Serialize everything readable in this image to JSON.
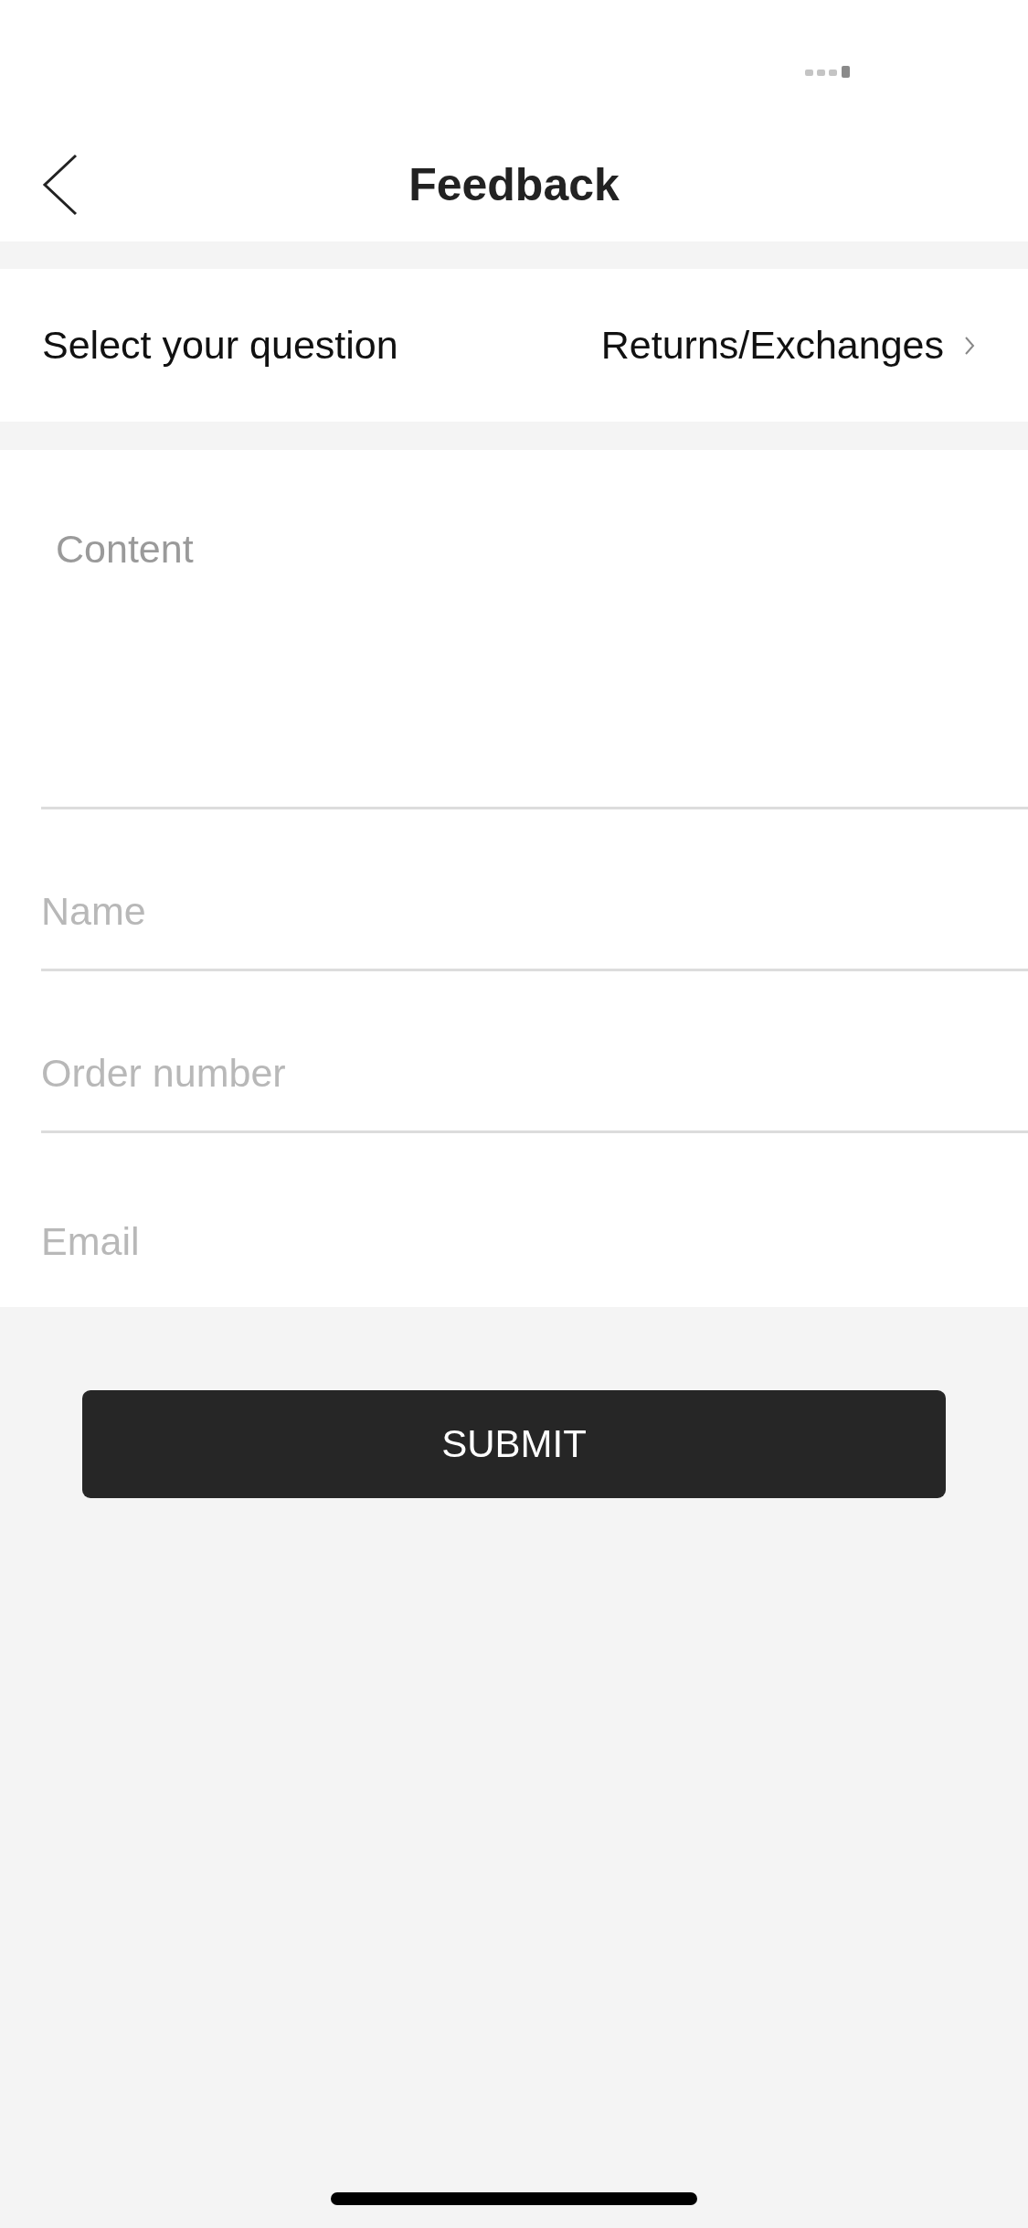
{
  "nav_bar": {
    "title": "Feedback"
  },
  "question_row": {
    "label": "Select your question",
    "value": "Returns/Exchanges"
  },
  "fields": [
    {
      "kind": "textarea",
      "placeholder": "Content"
    },
    {
      "kind": "input",
      "placeholder": "Name"
    },
    {
      "kind": "input",
      "placeholder": "Order number"
    },
    {
      "kind": "input",
      "placeholder": "Email"
    }
  ],
  "submit_button": {
    "label": "SUBMIT"
  }
}
